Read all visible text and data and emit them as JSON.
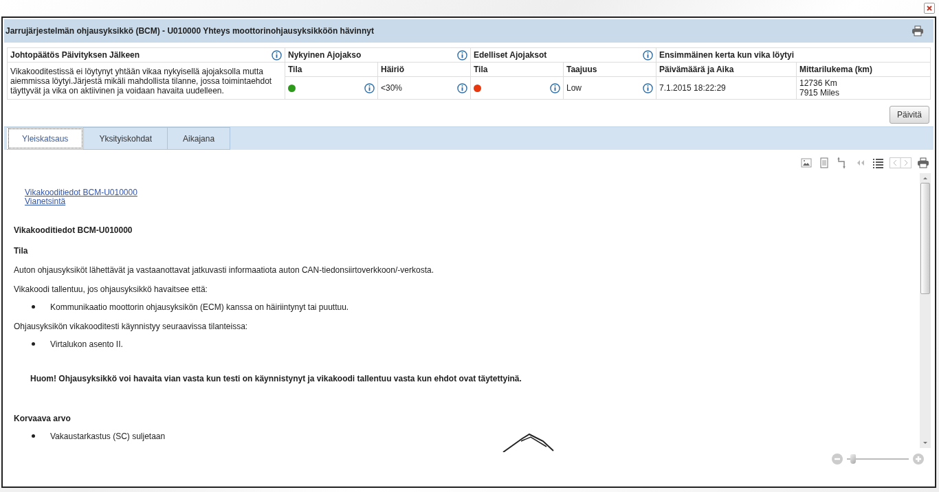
{
  "window": {
    "title": "Jarrujärjestelmän ohjausyksikkö (BCM) - U010000 Yhteys moottorinohjausyksikköön hävinnyt"
  },
  "summary": {
    "conclusion": {
      "heading": "Johtopäätös Päivityksen Jälkeen",
      "text": "Vikakooditestissä ei löytynyt yhtään vikaa nykyisellä ajojaksolla mutta aiemmissa löytyi.Järjestä mikäli mahdollista tilanne, jossa toimintaehdot täyttyvät ja vika on aktiivinen ja voidaan havaita uudelleen."
    },
    "current_cycle": {
      "heading": "Nykyinen Ajojakso",
      "status": {
        "label": "Tila",
        "color": "#2e9a1c"
      },
      "metric_label": "Häiriö",
      "metric_value": "<30%"
    },
    "previous_cycles": {
      "heading": "Edelliset Ajojaksot",
      "status": {
        "label": "Tila",
        "color": "#e8380f"
      },
      "metric_label": "Taajuus",
      "metric_value": "Low"
    },
    "first_found": {
      "heading": "Ensimmäinen kerta kun vika löytyi",
      "date_label": "Päivämäärä ja Aika",
      "date_value": "7.1.2015 18:22:29",
      "odometer_label": "Mittarilukema (km)",
      "odometer_values": [
        "12736 Km",
        "7915 Miles"
      ]
    }
  },
  "update_button": "Päivitä",
  "tabs": [
    {
      "label": "Yleiskatsaus",
      "selected": true
    },
    {
      "label": "Yksityiskohdat",
      "selected": false
    },
    {
      "label": "Aikajana",
      "selected": false
    }
  ],
  "links": [
    "Vikakooditiedot BCM-U010000",
    "Vianetsintä"
  ],
  "document": [
    {
      "kind": "title",
      "text": "Vikakooditiedot BCM-U010000"
    },
    {
      "kind": "heading",
      "text": "Tila"
    },
    {
      "kind": "paragraph",
      "text": "Auton ohjausyksiköt lähettävät ja vastaanottavat jatkuvasti informaatiota auton CAN-tiedonsiirtoverkkoon/-verkosta."
    },
    {
      "kind": "paragraph",
      "text": "Vikakoodi tallentuu, jos ohjausyksikkö havaitsee että:"
    },
    {
      "kind": "bullet",
      "text": "Kommunikaatio moottorin ohjausyksikön (ECM) kanssa on häiriintynyt tai puuttuu."
    },
    {
      "kind": "paragraph",
      "text": "Ohjausyksikön vikakooditesti käynnistyy seuraavissa tilanteissa:"
    },
    {
      "kind": "bullet",
      "text": "Virtalukon asento II."
    },
    {
      "kind": "note",
      "text": "Huom! Ohjausyksikkö voi havaita vian vasta kun testi on käynnistynyt ja vikakoodi tallentuu vasta kun ehdot ovat täytettyinä."
    },
    {
      "kind": "heading",
      "text": "Korvaava arvo"
    },
    {
      "kind": "bullet",
      "text": "Vakaustarkastus (SC) suljetaan"
    }
  ],
  "zoom": {
    "level": 0.1
  }
}
